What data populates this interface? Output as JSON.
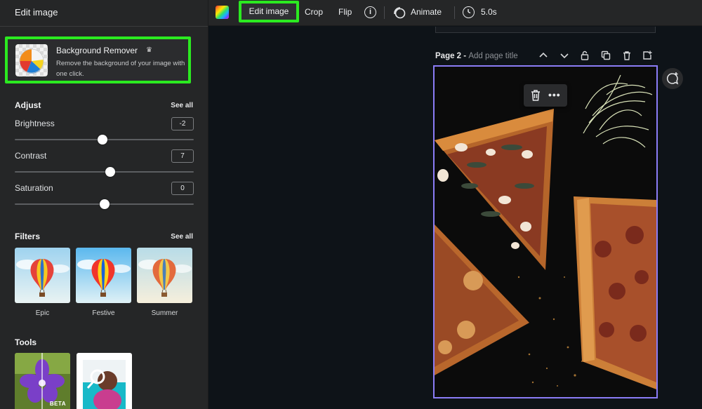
{
  "panel": {
    "title": "Edit image",
    "background_remover": {
      "title": "Background Remover",
      "description": "Remove the background of your image with one click.",
      "badge_icon": "crown-icon"
    },
    "adjust": {
      "heading": "Adjust",
      "see_all": "See all",
      "sliders": [
        {
          "label": "Brightness",
          "value": "-2",
          "level": 0.49
        },
        {
          "label": "Contrast",
          "value": "7",
          "level": 0.535
        },
        {
          "label": "Saturation",
          "value": "0",
          "level": 0.5
        }
      ]
    },
    "filters": {
      "heading": "Filters",
      "see_all": "See all",
      "items": [
        {
          "label": "Epic"
        },
        {
          "label": "Festive"
        },
        {
          "label": "Summer"
        }
      ]
    },
    "tools": {
      "heading": "Tools",
      "items": [
        {
          "badge": "BETA"
        },
        {
          "badge": ""
        }
      ]
    }
  },
  "toolbar": {
    "edit_image": "Edit image",
    "crop": "Crop",
    "flip": "Flip",
    "info": "i",
    "animate": "Animate",
    "duration": "5.0s"
  },
  "canvas": {
    "page_prefix": "Page 2 - ",
    "page_title_placeholder": "Add page title",
    "more": "•••"
  },
  "colors": {
    "highlight": "#2bea20",
    "selection": "#8b7cf6",
    "panel_bg": "#252627",
    "canvas_bg": "#0e1318"
  }
}
